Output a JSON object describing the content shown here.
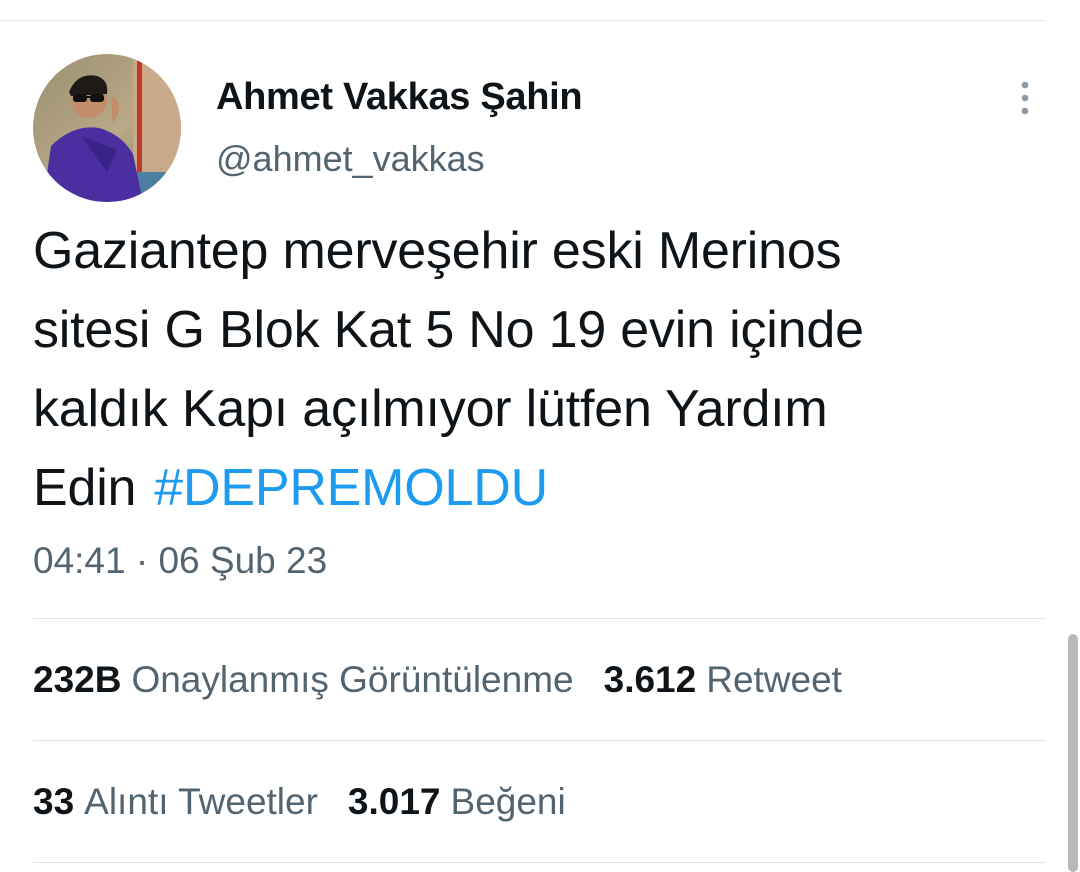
{
  "tweet": {
    "author": {
      "display_name": "Ahmet Vakkas Şahin",
      "handle": "@ahmet_vakkas"
    },
    "text_lines": [
      "Gaziantep merveşehir eski Merinos",
      "sitesi G Blok Kat 5 No 19 evin içinde",
      "kaldık Kapı açılmıyor lütfen Yardım"
    ],
    "text_last": "Edin",
    "hashtag": "#DEPREMOLDU",
    "timestamp": "04:41 · 06 Şub 23"
  },
  "stats": {
    "views": {
      "value": "232B",
      "label": "Onaylanmış Görüntülenme"
    },
    "retweets": {
      "value": "3.612",
      "label": "Retweet"
    },
    "quotes": {
      "value": "33",
      "label": "Alıntı Tweetler"
    },
    "likes": {
      "value": "3.017",
      "label": "Beğeni"
    }
  },
  "icons": {
    "more": "more-vertical-icon"
  },
  "colors": {
    "hashtag": "#1d9bf0",
    "secondary_text": "#536471",
    "primary_text": "#0f1419"
  }
}
